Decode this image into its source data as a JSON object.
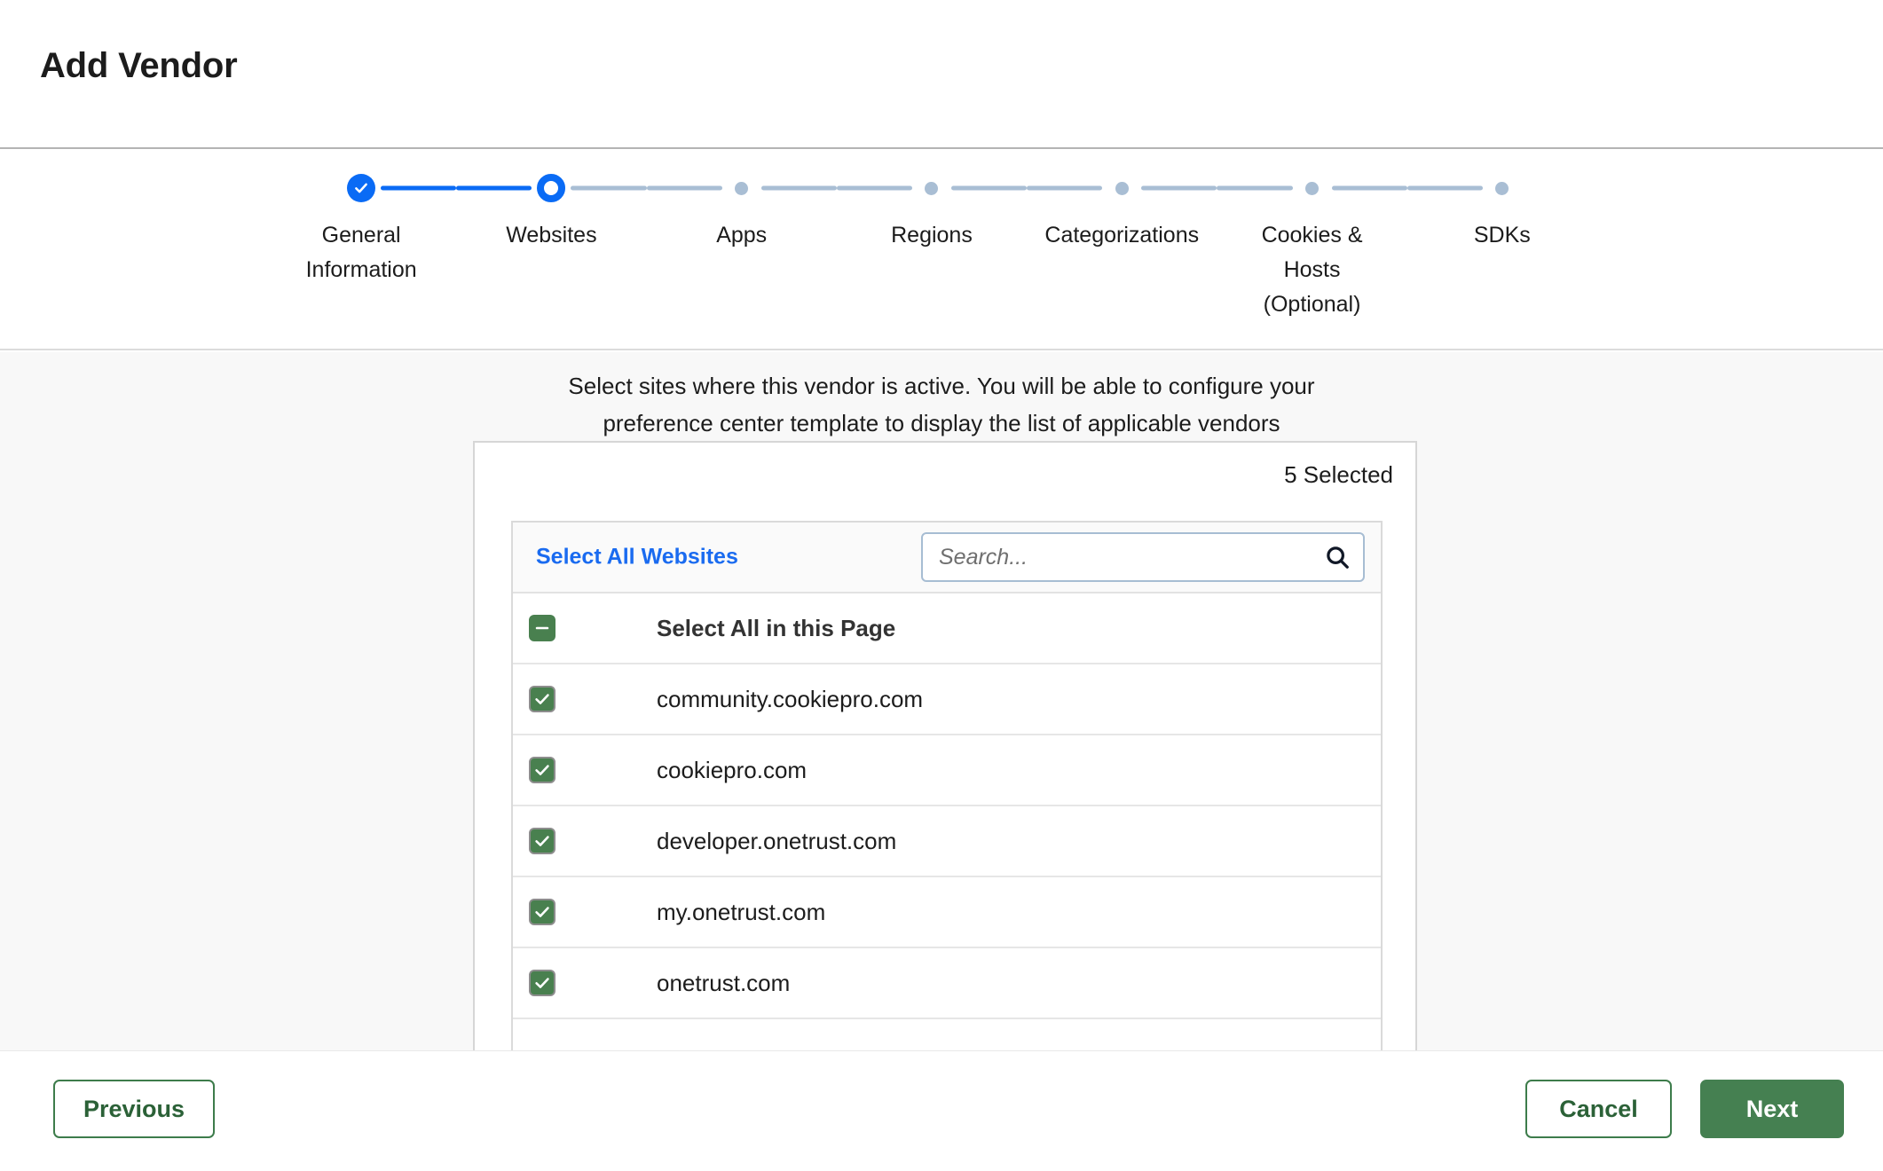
{
  "header": {
    "title": "Add Vendor"
  },
  "stepper": {
    "steps": [
      {
        "label": "General Information",
        "state": "done"
      },
      {
        "label": "Websites",
        "state": "active"
      },
      {
        "label": "Apps",
        "state": "todo"
      },
      {
        "label": "Regions",
        "state": "todo"
      },
      {
        "label": "Categorizations",
        "state": "todo"
      },
      {
        "label": "Cookies & Hosts (Optional)",
        "state": "todo"
      },
      {
        "label": "SDKs",
        "state": "todo"
      }
    ]
  },
  "main": {
    "instructions": "Select sites where this vendor is active. You will be able to configure your preference center template to display the list of applicable vendors",
    "selected_count_label": "5 Selected",
    "select_all_websites_label": "Select All Websites",
    "search": {
      "placeholder": "Search...",
      "value": "",
      "icon": "search-icon"
    },
    "list": {
      "header_row": {
        "label": "Select All in this Page",
        "checkbox_state": "indeterminate"
      },
      "rows": [
        {
          "label": "community.cookiepro.com",
          "checkbox_state": "checked"
        },
        {
          "label": "cookiepro.com",
          "checkbox_state": "checked"
        },
        {
          "label": "developer.onetrust.com",
          "checkbox_state": "checked"
        },
        {
          "label": "my.onetrust.com",
          "checkbox_state": "checked"
        },
        {
          "label": "onetrust.com",
          "checkbox_state": "checked"
        }
      ]
    }
  },
  "footer": {
    "previous_label": "Previous",
    "cancel_label": "Cancel",
    "next_label": "Next"
  },
  "colors": {
    "accent_blue": "#0a6bf5",
    "link_blue": "#1a6bf0",
    "step_inactive": "#a9bed4",
    "brand_green": "#458051",
    "green_border": "#3d7c4b",
    "page_bg": "#f8f8f8"
  }
}
